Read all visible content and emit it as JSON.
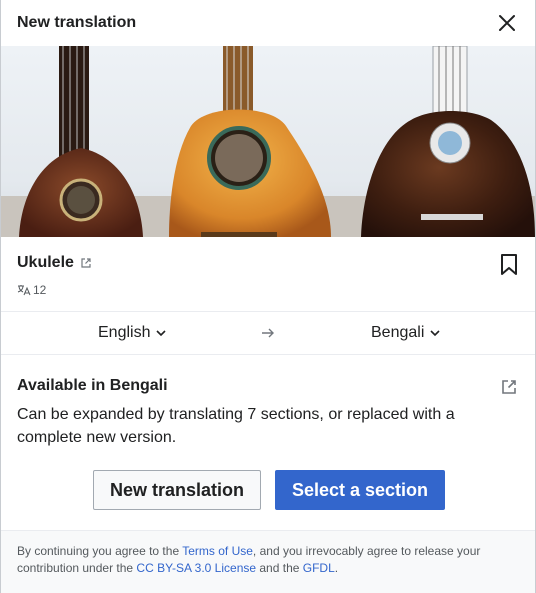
{
  "dialog": {
    "title": "New translation",
    "close_icon": "close-icon"
  },
  "article": {
    "title": "Ukulele",
    "language_count": "12",
    "external_icon": "external-link-icon",
    "bookmark_icon": "bookmark-icon",
    "langcount_icon": "language-icon"
  },
  "languages": {
    "source": "English",
    "target": "Bengali",
    "arrow_icon": "arrow-right-icon"
  },
  "availability": {
    "heading": "Available in Bengali",
    "description": "Can be expanded by translating 7 sections, or replaced with a complete new version."
  },
  "buttons": {
    "new_translation": "New translation",
    "select_section": "Select a section"
  },
  "footer": {
    "text_1": "By continuing you agree to the ",
    "terms_link": "Terms of Use",
    "text_2": ", and you irrevocably agree to release your contribution under the ",
    "license_link": "CC BY-SA 3.0 License",
    "text_3": " and the ",
    "gfdl_link": "GFDL",
    "text_4": "."
  },
  "colors": {
    "primary": "#3366cc",
    "text": "#202122",
    "muted": "#54595d"
  }
}
